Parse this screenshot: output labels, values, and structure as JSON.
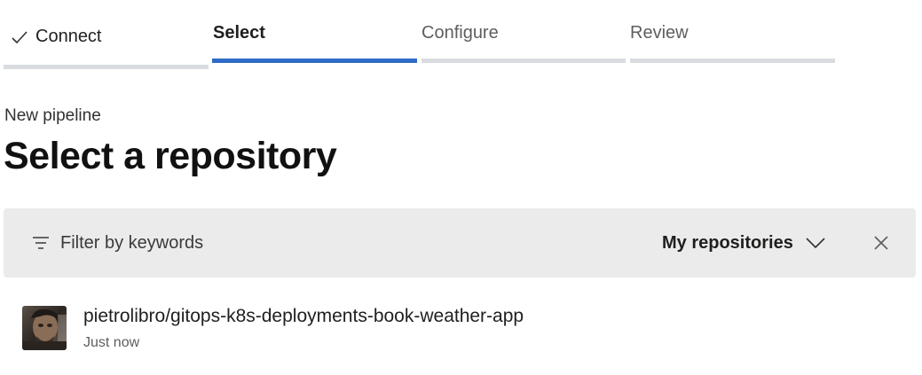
{
  "wizard": {
    "steps": [
      {
        "label": "Connect",
        "status": "completed"
      },
      {
        "label": "Select",
        "status": "active"
      },
      {
        "label": "Configure",
        "status": "upcoming"
      },
      {
        "label": "Review",
        "status": "upcoming"
      }
    ],
    "active_color": "#2f6cc7",
    "inactive_color": "#d8dce0"
  },
  "header": {
    "breadcrumb": "New pipeline",
    "title": "Select a repository"
  },
  "filter": {
    "icon": "filter-icon",
    "placeholder": "Filter by keywords",
    "value": "",
    "scope_label": "My repositories",
    "scope_icon": "chevron-down-icon",
    "clear_icon": "close-icon"
  },
  "repositories": [
    {
      "name": "pietrolibro/gitops-k8s-deployments-book-weather-app",
      "time": "Just now",
      "avatar_icon": "user-avatar"
    }
  ]
}
